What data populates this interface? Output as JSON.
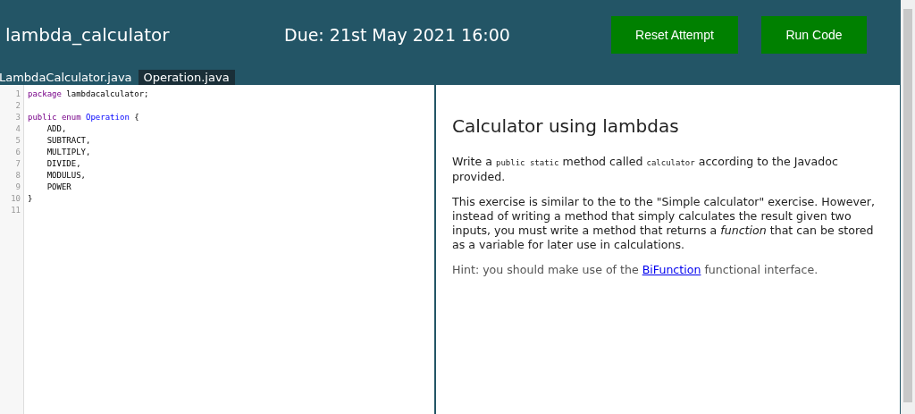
{
  "header": {
    "title": "lambda_calculator",
    "due": "Due: 21st May 2021 16:00",
    "buttons": [
      "Reset Attempt",
      "Run Code"
    ]
  },
  "tabs": [
    {
      "label": "LambdaCalculator.java",
      "selected": false
    },
    {
      "label": "Operation.java",
      "selected": true
    }
  ],
  "editor": {
    "lines": [
      {
        "number": "1",
        "tokens": [
          {
            "kind": "keyword",
            "text": "package"
          },
          {
            "kind": "plain",
            "text": " lambdacalculator;"
          }
        ]
      },
      {
        "number": "2"
      },
      {
        "number": "3",
        "tokens": [
          {
            "kind": "keyword",
            "text": "public enum "
          },
          {
            "kind": "type",
            "text": "Operation"
          },
          {
            "kind": "plain",
            "text": " {"
          }
        ]
      },
      {
        "number": "4",
        "tokens": [
          {
            "kind": "plain",
            "text": "    ADD,"
          }
        ]
      },
      {
        "number": "5",
        "tokens": [
          {
            "kind": "plain",
            "text": "    SUBTRACT,"
          }
        ]
      },
      {
        "number": "6",
        "tokens": [
          {
            "kind": "plain",
            "text": "    MULTIPLY,"
          }
        ]
      },
      {
        "number": "7",
        "tokens": [
          {
            "kind": "plain",
            "text": "    DIVIDE,"
          }
        ]
      },
      {
        "number": "8",
        "tokens": [
          {
            "kind": "plain",
            "text": "    MODULUS,"
          }
        ]
      },
      {
        "number": "9",
        "tokens": [
          {
            "kind": "plain",
            "text": "    POWER"
          }
        ]
      },
      {
        "number": "10",
        "tokens": [
          {
            "kind": "plain",
            "text": "}"
          }
        ]
      },
      {
        "number": "11"
      }
    ]
  },
  "instructions": {
    "heading": "Calculator using lambdas",
    "paragraphs": [
      {
        "kind": "body",
        "parts": [
          {
            "kind": "text",
            "text": "Write a "
          },
          {
            "kind": "code",
            "text": "public static"
          },
          {
            "kind": "text",
            "text": " method called "
          },
          {
            "kind": "code",
            "text": "calculator"
          },
          {
            "kind": "text",
            "text": " according to the Javadoc provided."
          }
        ]
      },
      {
        "kind": "body",
        "parts": [
          {
            "kind": "text",
            "text": "This exercise is similar to the to the \"Simple calculator\" exercise. However, instead of writing a method that simply calculates the result given two inputs, you must write a method that returns a "
          },
          {
            "kind": "em",
            "text": "function"
          },
          {
            "kind": "text",
            "text": " that can be stored as a variable for later use in calculations."
          }
        ]
      },
      {
        "kind": "hint",
        "parts": [
          {
            "kind": "text",
            "text": "Hint: you should make use of the "
          },
          {
            "kind": "link",
            "text": "BiFunction"
          },
          {
            "kind": "text",
            "text": " functional interface."
          }
        ]
      }
    ]
  }
}
